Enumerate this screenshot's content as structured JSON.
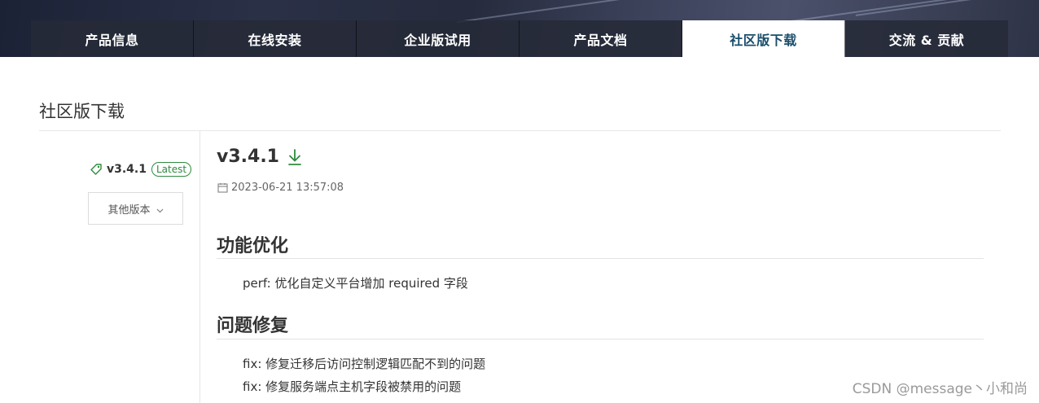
{
  "nav": {
    "items": [
      {
        "label": "产品信息"
      },
      {
        "label": "在线安装"
      },
      {
        "label": "企业版试用"
      },
      {
        "label": "产品文档"
      },
      {
        "label": "社区版下载"
      },
      {
        "label": "交流 & 贡献"
      }
    ],
    "active_index": 4
  },
  "page": {
    "title": "社区版下载"
  },
  "sidebar": {
    "tag_icon": "tag-icon",
    "version": "v3.4.1",
    "badge": "Latest",
    "other_versions_label": "其他版本"
  },
  "release": {
    "version": "v3.4.1",
    "download_icon": "download-icon",
    "date": "2023-06-21 13:57:08",
    "sections": [
      {
        "heading": "功能优化",
        "items": [
          "perf: 优化自定义平台增加 required 字段"
        ]
      },
      {
        "heading": "问题修复",
        "items": [
          "fix: 修复迁移后访问控制逻辑匹配不到的问题",
          "fix: 修复服务端点主机字段被禁用的问题"
        ]
      }
    ]
  },
  "watermark": "CSDN @message丶小和尚",
  "colors": {
    "accent_green": "#2e8b3e",
    "nav_active_text": "#1a4d6b",
    "nav_bg": "#262a38"
  }
}
